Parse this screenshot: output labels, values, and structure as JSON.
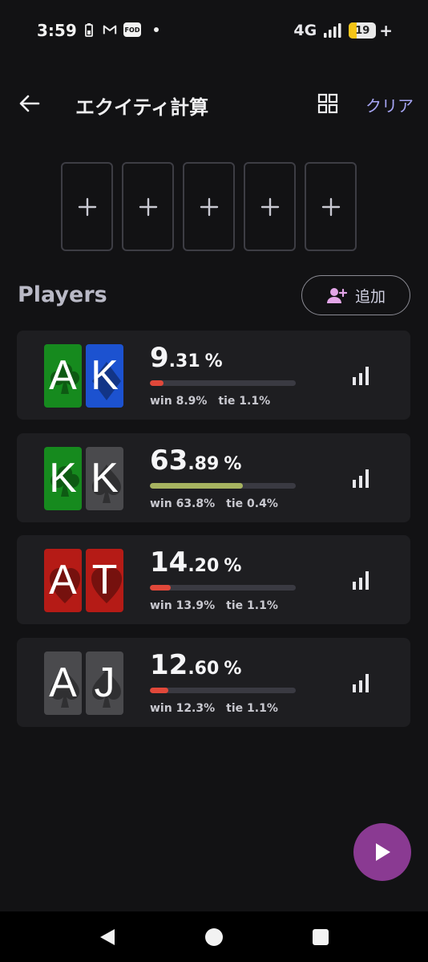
{
  "status_bar": {
    "time": "3:59",
    "network": "4G",
    "battery_level": "19",
    "icons": [
      "battery-saver-icon",
      "gmail-icon",
      "fod-app-icon",
      "notification-dot-icon",
      "signal-icon",
      "battery-icon"
    ],
    "fod_label": "FOD"
  },
  "app_bar": {
    "title": "エクイティ計算",
    "clear_label": "クリア",
    "accent_color": "#a7a6f5"
  },
  "board": {
    "slot_count": 5,
    "slot_symbol": "+"
  },
  "players_section": {
    "title": "Players",
    "add_label": "追加"
  },
  "players": [
    {
      "cards": [
        {
          "rank": "A",
          "suit": "clubs",
          "color": "#168a1e"
        },
        {
          "rank": "K",
          "suit": "diamonds",
          "color": "#1c52d0"
        }
      ],
      "equity_int": "9",
      "equity_dec": ".31",
      "equity_unit": "%",
      "equity_value": 9.31,
      "bar_color": "#e0483a",
      "win": "win 8.9%",
      "tie": "tie 1.1%"
    },
    {
      "cards": [
        {
          "rank": "K",
          "suit": "clubs",
          "color": "#168a1e"
        },
        {
          "rank": "K",
          "suit": "spades",
          "color": "#4a4a4d"
        }
      ],
      "equity_int": "63",
      "equity_dec": ".89",
      "equity_unit": "%",
      "equity_value": 63.89,
      "bar_color": "#a6b360",
      "win": "win 63.8%",
      "tie": "tie 0.4%"
    },
    {
      "cards": [
        {
          "rank": "A",
          "suit": "hearts",
          "color": "#b51b16"
        },
        {
          "rank": "T",
          "suit": "hearts",
          "color": "#b51b16"
        }
      ],
      "equity_int": "14",
      "equity_dec": ".20",
      "equity_unit": "%",
      "equity_value": 14.2,
      "bar_color": "#e0483a",
      "win": "win 13.9%",
      "tie": "tie 1.1%"
    },
    {
      "cards": [
        {
          "rank": "A",
          "suit": "spades",
          "color": "#4a4a4d"
        },
        {
          "rank": "J",
          "suit": "spades",
          "color": "#4a4a4d"
        }
      ],
      "equity_int": "12",
      "equity_dec": ".60",
      "equity_unit": "%",
      "equity_value": 12.6,
      "bar_color": "#e0483a",
      "win": "win 12.3%",
      "tie": "tie 1.1%"
    }
  ],
  "fab": {
    "icon": "play-icon",
    "color": "#8a3a92"
  },
  "nav": {
    "icons": [
      "back-nav-icon",
      "home-nav-icon",
      "recents-nav-icon"
    ]
  }
}
